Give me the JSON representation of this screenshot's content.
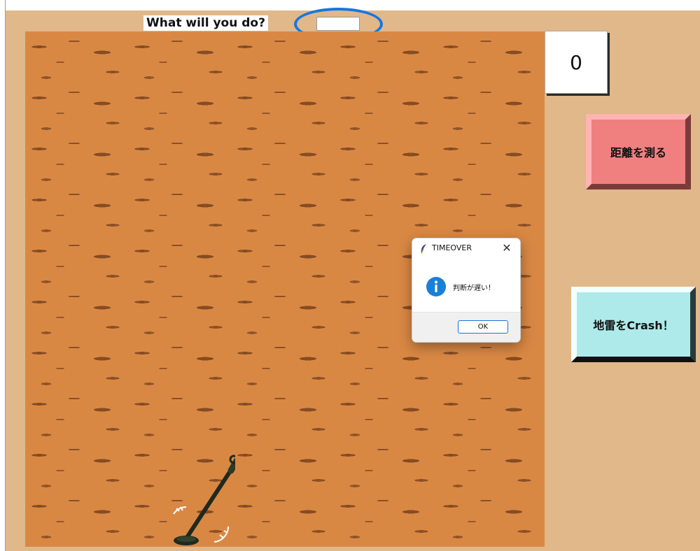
{
  "prompt": {
    "label": "What will you do?",
    "input_value": "",
    "input_placeholder": ""
  },
  "score": {
    "value": "0"
  },
  "buttons": {
    "measure": {
      "label": "距離を測る",
      "face_color": "#f08080"
    },
    "crash": {
      "label": "地雷をCrash！",
      "face_color": "#aeeaea"
    }
  },
  "dialog": {
    "title": "TIMEOVER",
    "message": "判断が遅い！",
    "ok_label": "OK",
    "close_icon": "close-icon",
    "app_icon": "feather-icon",
    "status_icon": "info-icon"
  },
  "colors": {
    "background": "#e0b88a",
    "field": "#d98844",
    "highlight_ring": "#1677e0"
  }
}
